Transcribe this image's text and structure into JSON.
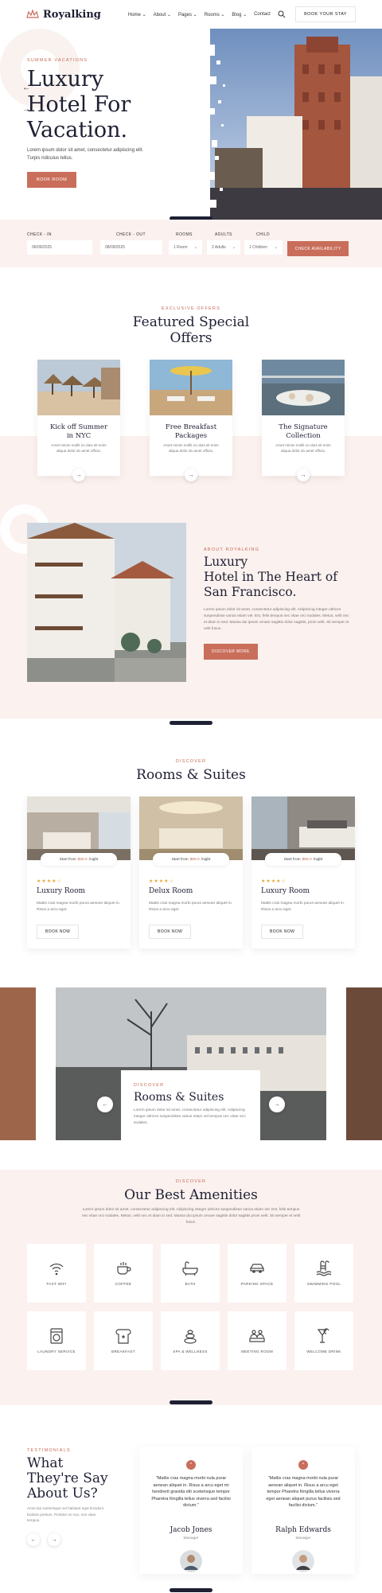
{
  "header": {
    "logo": "Royalking",
    "nav": [
      "Home ⌄",
      "About ⌄",
      "Pages ⌄",
      "Rooms ⌄",
      "Blog ⌄",
      "Contact"
    ],
    "book_button": "BOOK YOUR STAY"
  },
  "hero": {
    "eyebrow": "SUMMER VACATIONS",
    "title_line1": "Luxury",
    "title_line2": "Hotel For",
    "title_line3": "Vacation.",
    "text": "Lorem ipsum dolor sit amet, consectetur adipiscing elit. Turpis ridiculus tellus.",
    "button": "BOOK ROOM"
  },
  "booking": {
    "checkin_label": "CHECK - IN",
    "checkin_value": "06/09/2025",
    "checkout_label": "CHECK - OUT",
    "checkout_value": "08/09/2025",
    "rooms_label": "ROOMS",
    "rooms_value": "1 Room",
    "adults_label": "ADULTS",
    "adults_value": "2 Adults",
    "child_label": "CHILD",
    "child_value": "1 Children",
    "button": "CHECK AVAILABILITY"
  },
  "offers": {
    "eyebrow": "EXCLUSIVE OFFERS",
    "title_line1": "Featured Special",
    "title_line2": "Offers",
    "cards": [
      {
        "title_line1": "Kick off Summer",
        "title_line2": "in NYC",
        "text": "Amet minim mollit no duis sit enim aliqua dolor do amet officia."
      },
      {
        "title_line1": "Free Breakfast",
        "title_line2": "Packages",
        "text": "Amet minim mollit no duis sit enim aliqua dolor do amet officia."
      },
      {
        "title_line1": "The Signature",
        "title_line2": "Collection",
        "text": "Amet minim mollit no duis sit enim aliqua dolor do amet officia."
      }
    ]
  },
  "about": {
    "eyebrow": "ABOUT ROYALKING",
    "title_line1": "Luxury",
    "title_line2": "Hotel in The Heart of",
    "title_line3": "San Francisco.",
    "text": "Lorem ipsum dolor sit amet, consectetur adipiscing elit. Adipiscing integer ultrices suspendisse varius etiam vel. Est, felis tempus nec vitae orci sodales. Metus, velit nec et diam in sed. Massa dui ipsum ornare sagittis dolor sagittis, proin velit. Sit semper et velit fusce.",
    "button": "DISCOVER MORE"
  },
  "rooms": {
    "eyebrow": "DISCOVER",
    "title": "Rooms & Suites",
    "cards": [
      {
        "price_prefix": "Start from",
        "price": "$55.0",
        "price_suffix": "/night",
        "stars": "★★★★☆",
        "name": "Luxury Room",
        "text": "Mattis cras magna morbi purus aenean aliquet in. Risus a arcu eget.",
        "button": "BOOK NOW"
      },
      {
        "price_prefix": "Start from",
        "price": "$55.0",
        "price_suffix": "/night",
        "stars": "★★★★☆",
        "name": "Delux Room",
        "text": "Mattis cras magna morbi purus aenean aliquet in. Risus a arcu eget.",
        "button": "BOOK NOW"
      },
      {
        "price_prefix": "Start from",
        "price": "$55.0",
        "price_suffix": "/night",
        "stars": "★★★★☆",
        "name": "Luxury Room",
        "text": "Mattis cras magna morbi purus aenean aliquet in. Risus a arcu eget.",
        "button": "BOOK NOW"
      }
    ]
  },
  "gallery": {
    "eyebrow": "DISCOVER",
    "title": "Rooms & Suites",
    "text": "Lorem ipsum dolor sit amet, consectetur adipiscing elit. Adipiscing integer ultrices suspendisse varius etiam vel tempus nec vitae orci sodales."
  },
  "amenities": {
    "eyebrow": "DISCOVER",
    "title": "Our Best Amenities",
    "text": "Lorem ipsum dolor sit amet, consectetur adipiscing elit. Adipiscing integer ultrices suspendisse varius etiam vel. Est, felis tempus nec vitae orci sodales. Metus, velit nec et diam in sed. Massa dui ipsum ornare sagittis dolor sagittis proin velit. Sit semper et velit fusce.",
    "items": [
      {
        "label": "FAST WIFI",
        "icon": "wifi-icon"
      },
      {
        "label": "COFFEE",
        "icon": "coffee-icon"
      },
      {
        "label": "BATH",
        "icon": "bath-icon"
      },
      {
        "label": "PARKING SPACE",
        "icon": "car-icon"
      },
      {
        "label": "SWIMMING POOL",
        "icon": "pool-icon"
      },
      {
        "label": "LAUNDRY SERVICE",
        "icon": "washer-icon"
      },
      {
        "label": "BREAKFAST",
        "icon": "bread-icon"
      },
      {
        "label": "SPA & WELLNESS",
        "icon": "spa-icon"
      },
      {
        "label": "MEETING ROOM",
        "icon": "meeting-icon"
      },
      {
        "label": "WELCOME DRINK",
        "icon": "drink-icon"
      }
    ]
  },
  "testimonials": {
    "eyebrow": "TESTIMONIALS",
    "title_line1": "What",
    "title_line2": "They're Say",
    "title_line3": "About Us?",
    "text": "Amet dui scelerisque vel habitant eget tincidunt facilisis pretium. Porttitor mi non, non vitae tempus.",
    "cards": [
      {
        "quote": "\"Mattis cras magna morbi nula purar aenean aliquet in. Risus a arcu eget mi hendrerit gravida elit scelerisque tempor Pharetra fringilla tellus viverra sed facilisi dictum.\"",
        "name": "Jacob Jones",
        "role": "Manager"
      },
      {
        "quote": "\"Mattis cras magna morbi nula purar aenean aliquet in. Risus a arcu eget tempor Pharetra fringilla tellus viverra eget aenean aliquet purus facilisis sed facilisi dictum.\"",
        "name": "Ralph Edwards",
        "role": "Manager"
      }
    ]
  },
  "colors": {
    "accent": "#c96e5b",
    "dark": "#1e2033",
    "blush": "#fbf1ee"
  }
}
